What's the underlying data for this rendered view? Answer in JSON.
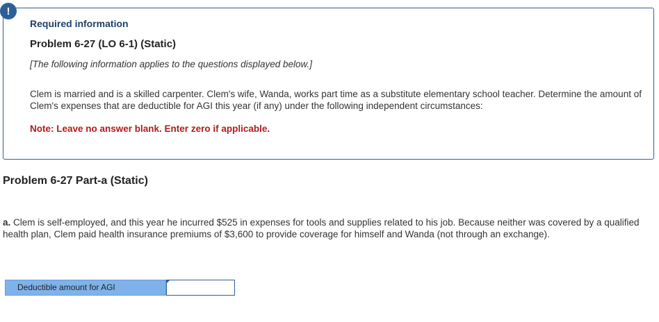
{
  "alert_symbol": "!",
  "info": {
    "required_title": "Required information",
    "problem_title": "Problem 6-27 (LO 6-1) (Static)",
    "italic_note": "[The following information applies to the questions displayed below.]",
    "scenario": "Clem is married and is a skilled carpenter. Clem's wife, Wanda, works part time as a substitute elementary school teacher. Determine the amount of Clem's expenses that are deductible for AGI this year (if any) under the following independent circumstances:",
    "note": "Note: Leave no answer blank. Enter zero if applicable."
  },
  "part": {
    "title": "Problem 6-27 Part-a (Static)",
    "question_prefix": "a.",
    "question_text": " Clem is self-employed, and this year he incurred $525 in expenses for tools and supplies related to his job. Because neither was covered by a qualified health plan, Clem paid health insurance premiums of $3,600 to provide coverage for himself and Wanda (not through an exchange)."
  },
  "answer": {
    "label": "Deductible amount for AGI",
    "value": ""
  },
  "colors": {
    "accent": "#2f5f98",
    "note_red": "#b31b1b",
    "label_bg": "#7fb2ea"
  }
}
